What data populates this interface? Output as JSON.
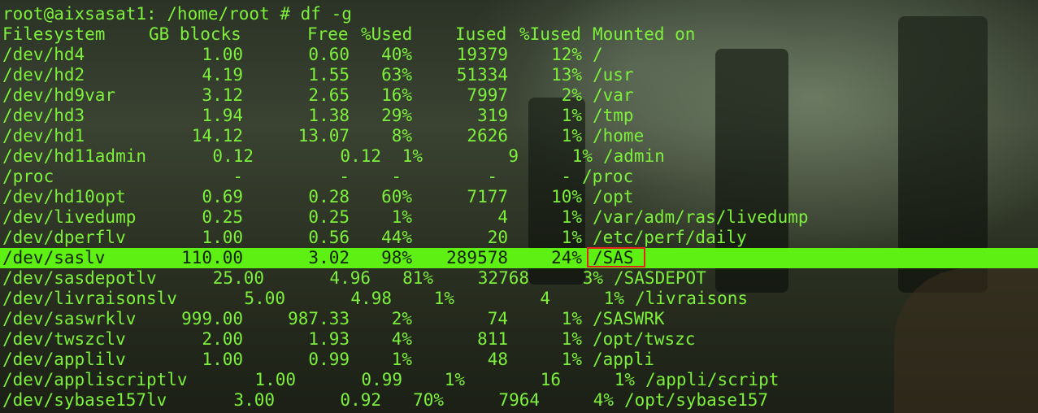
{
  "prompt_line": "root@aixsasat1: /home/root # df -g",
  "headers": {
    "filesystem": "Filesystem",
    "gb_blocks": "GB blocks",
    "free": "Free",
    "pct_used": "%Used",
    "iused": "Iused",
    "pct_iused": "%Iused",
    "mounted_on": "Mounted on"
  },
  "rows": [
    {
      "fs": "/dev/hd4",
      "blocks": "1.00",
      "free": "0.60",
      "used": "40%",
      "iused": "19379",
      "piused": "12%",
      "mount": "/"
    },
    {
      "fs": "/dev/hd2",
      "blocks": "4.19",
      "free": "1.55",
      "used": "63%",
      "iused": "51334",
      "piused": "13%",
      "mount": "/usr"
    },
    {
      "fs": "/dev/hd9var",
      "blocks": "3.12",
      "free": "2.65",
      "used": "16%",
      "iused": "7997",
      "piused": "2%",
      "mount": "/var"
    },
    {
      "fs": "/dev/hd3",
      "blocks": "1.94",
      "free": "1.38",
      "used": "29%",
      "iused": "319",
      "piused": "1%",
      "mount": "/tmp"
    },
    {
      "fs": "/dev/hd1",
      "blocks": "14.12",
      "free": "13.07",
      "used": "8%",
      "iused": "2626",
      "piused": "1%",
      "mount": "/home"
    },
    {
      "fs": "/dev/hd11admin",
      "blocks": "0.12",
      "free": "0.12",
      "used": "1%",
      "iused": "9",
      "piused": "1%",
      "mount": "/admin"
    },
    {
      "fs": "/proc",
      "blocks": "-",
      "free": "-",
      "used": "-",
      "iused": "-",
      "piused": "-",
      "mount": "/proc"
    },
    {
      "fs": "/dev/hd10opt",
      "blocks": "0.69",
      "free": "0.28",
      "used": "60%",
      "iused": "7177",
      "piused": "10%",
      "mount": "/opt"
    },
    {
      "fs": "/dev/livedump",
      "blocks": "0.25",
      "free": "0.25",
      "used": "1%",
      "iused": "4",
      "piused": "1%",
      "mount": "/var/adm/ras/livedump"
    },
    {
      "fs": "/dev/dperflv",
      "blocks": "1.00",
      "free": "0.56",
      "used": "44%",
      "iused": "20",
      "piused": "1%",
      "mount": "/etc/perf/daily"
    },
    {
      "fs": "/dev/saslv",
      "blocks": "110.00",
      "free": "3.02",
      "used": "98%",
      "iused": "289578",
      "piused": "24%",
      "mount": "/SAS"
    },
    {
      "fs": "/dev/sasdepotlv",
      "blocks": "25.00",
      "free": "4.96",
      "used": "81%",
      "iused": "32768",
      "piused": "3%",
      "mount": "/SASDEPOT"
    },
    {
      "fs": "/dev/livraisonslv",
      "blocks": "5.00",
      "free": "4.98",
      "used": "1%",
      "iused": "4",
      "piused": "1%",
      "mount": "/livraisons"
    },
    {
      "fs": "/dev/saswrklv",
      "blocks": "999.00",
      "free": "987.33",
      "used": "2%",
      "iused": "74",
      "piused": "1%",
      "mount": "/SASWRK"
    },
    {
      "fs": "/dev/twszclv",
      "blocks": "2.00",
      "free": "1.93",
      "used": "4%",
      "iused": "811",
      "piused": "1%",
      "mount": "/opt/twszc"
    },
    {
      "fs": "/dev/applilv",
      "blocks": "1.00",
      "free": "0.99",
      "used": "1%",
      "iused": "48",
      "piused": "1%",
      "mount": "/appli"
    },
    {
      "fs": "/dev/appliscriptlv",
      "blocks": "1.00",
      "free": "0.99",
      "used": "1%",
      "iused": "16",
      "piused": "1%",
      "mount": "/appli/script"
    },
    {
      "fs": "/dev/sybase157lv",
      "blocks": "3.00",
      "free": "0.92",
      "used": "70%",
      "iused": "7964",
      "piused": "4%",
      "mount": "/opt/sybase157"
    }
  ],
  "highlight_row_index": 10,
  "colors": {
    "terminal_text": "#7cf03a",
    "highlight_bg": "#5ef012",
    "highlight_text": "#10220a",
    "annotation_box": "#e0241b"
  }
}
